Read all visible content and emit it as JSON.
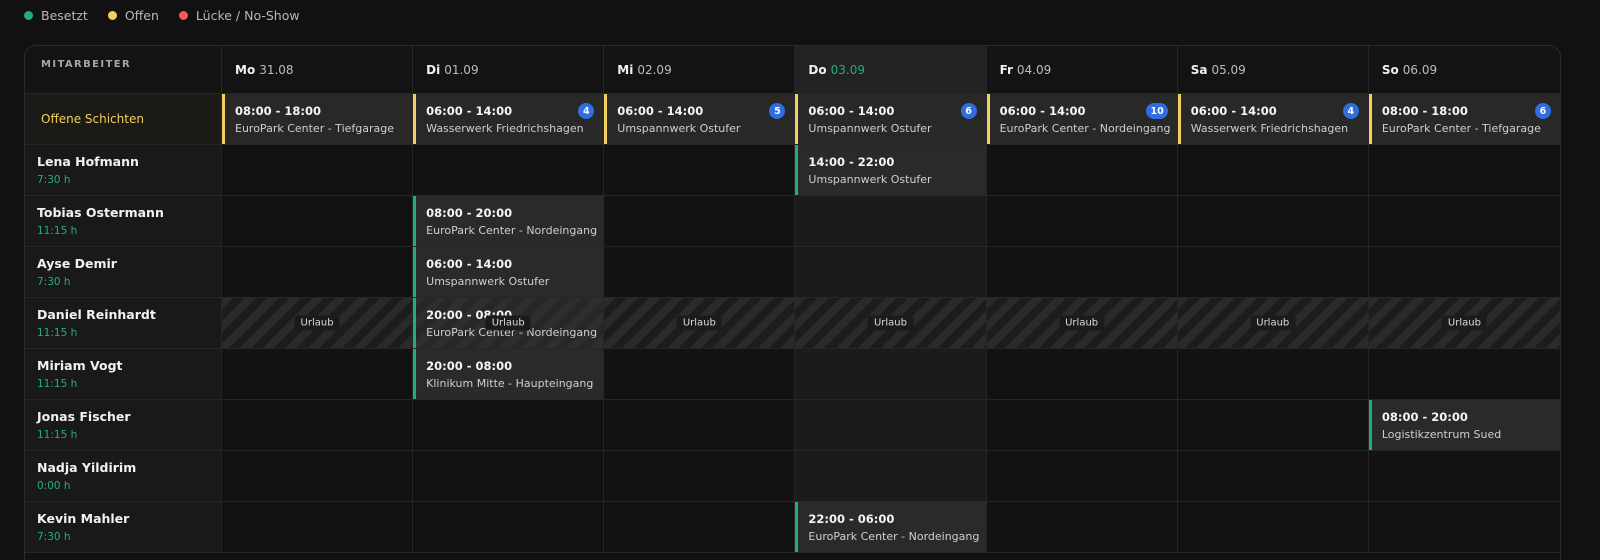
{
  "legend": [
    {
      "label": "Besetzt",
      "color": "#1fb07a"
    },
    {
      "label": "Offen",
      "color": "#f3cf5e"
    },
    {
      "label": "Lücke / No-Show",
      "color": "#ef5b5b"
    }
  ],
  "corner_label": "MITARBEITER",
  "days": [
    {
      "name": "Mo",
      "date": "31.08"
    },
    {
      "name": "Di",
      "date": "01.09"
    },
    {
      "name": "Mi",
      "date": "02.09"
    },
    {
      "name": "Do",
      "date": "03.09",
      "today": true
    },
    {
      "name": "Fr",
      "date": "04.09"
    },
    {
      "name": "Sa",
      "date": "05.09"
    },
    {
      "name": "So",
      "date": "06.09"
    }
  ],
  "open_shifts": {
    "label": "Offene Schichten",
    "cells": [
      {
        "time": "08:00 - 18:00",
        "location": "EuroPark Center - Tiefgarage",
        "count": ""
      },
      {
        "time": "06:00 - 14:00",
        "location": "Wasserwerk Friedrichshagen",
        "count": "4"
      },
      {
        "time": "06:00 - 14:00",
        "location": "Umspannwerk Ostufer",
        "count": "5"
      },
      {
        "time": "06:00 - 14:00",
        "location": "Umspannwerk Ostufer",
        "count": "6"
      },
      {
        "time": "06:00 - 14:00",
        "location": "EuroPark Center - Nordeingang",
        "count": "10"
      },
      {
        "time": "06:00 - 14:00",
        "location": "Wasserwerk Friedrichshagen",
        "count": "4"
      },
      {
        "time": "08:00 - 18:00",
        "location": "EuroPark Center - Tiefgarage",
        "count": "6"
      }
    ]
  },
  "leave_label": "Urlaub",
  "employees": [
    {
      "name": "Lena Hofmann",
      "hours": "7:30 h",
      "shifts": {
        "3": {
          "time": "14:00 - 22:00",
          "location": "Umspannwerk Ostufer"
        }
      }
    },
    {
      "name": "Tobias Ostermann",
      "hours": "11:15 h",
      "shifts": {
        "1": {
          "time": "08:00 - 20:00",
          "location": "EuroPark Center - Nordeingang"
        }
      }
    },
    {
      "name": "Ayse Demir",
      "hours": "7:30 h",
      "shifts": {
        "1": {
          "time": "06:00 - 14:00",
          "location": "Umspannwerk Ostufer"
        }
      }
    },
    {
      "name": "Daniel Reinhardt",
      "hours": "11:15 h",
      "leave": true,
      "shifts": {
        "1": {
          "time": "20:00 - 08:00",
          "location": "EuroPark Center - Nordeingang"
        }
      }
    },
    {
      "name": "Miriam Vogt",
      "hours": "11:15 h",
      "shifts": {
        "1": {
          "time": "20:00 - 08:00",
          "location": "Klinikum Mitte - Haupteingang"
        }
      }
    },
    {
      "name": "Jonas Fischer",
      "hours": "11:15 h",
      "shifts": {
        "6": {
          "time": "08:00 - 20:00",
          "location": "Logistikzentrum Sued"
        }
      }
    },
    {
      "name": "Nadja Yildirim",
      "hours": "0:00 h",
      "shifts": {}
    },
    {
      "name": "Kevin Mahler",
      "hours": "7:30 h",
      "shifts": {
        "3": {
          "time": "22:00 - 06:00",
          "location": "EuroPark Center - Nordeingang"
        }
      }
    }
  ]
}
